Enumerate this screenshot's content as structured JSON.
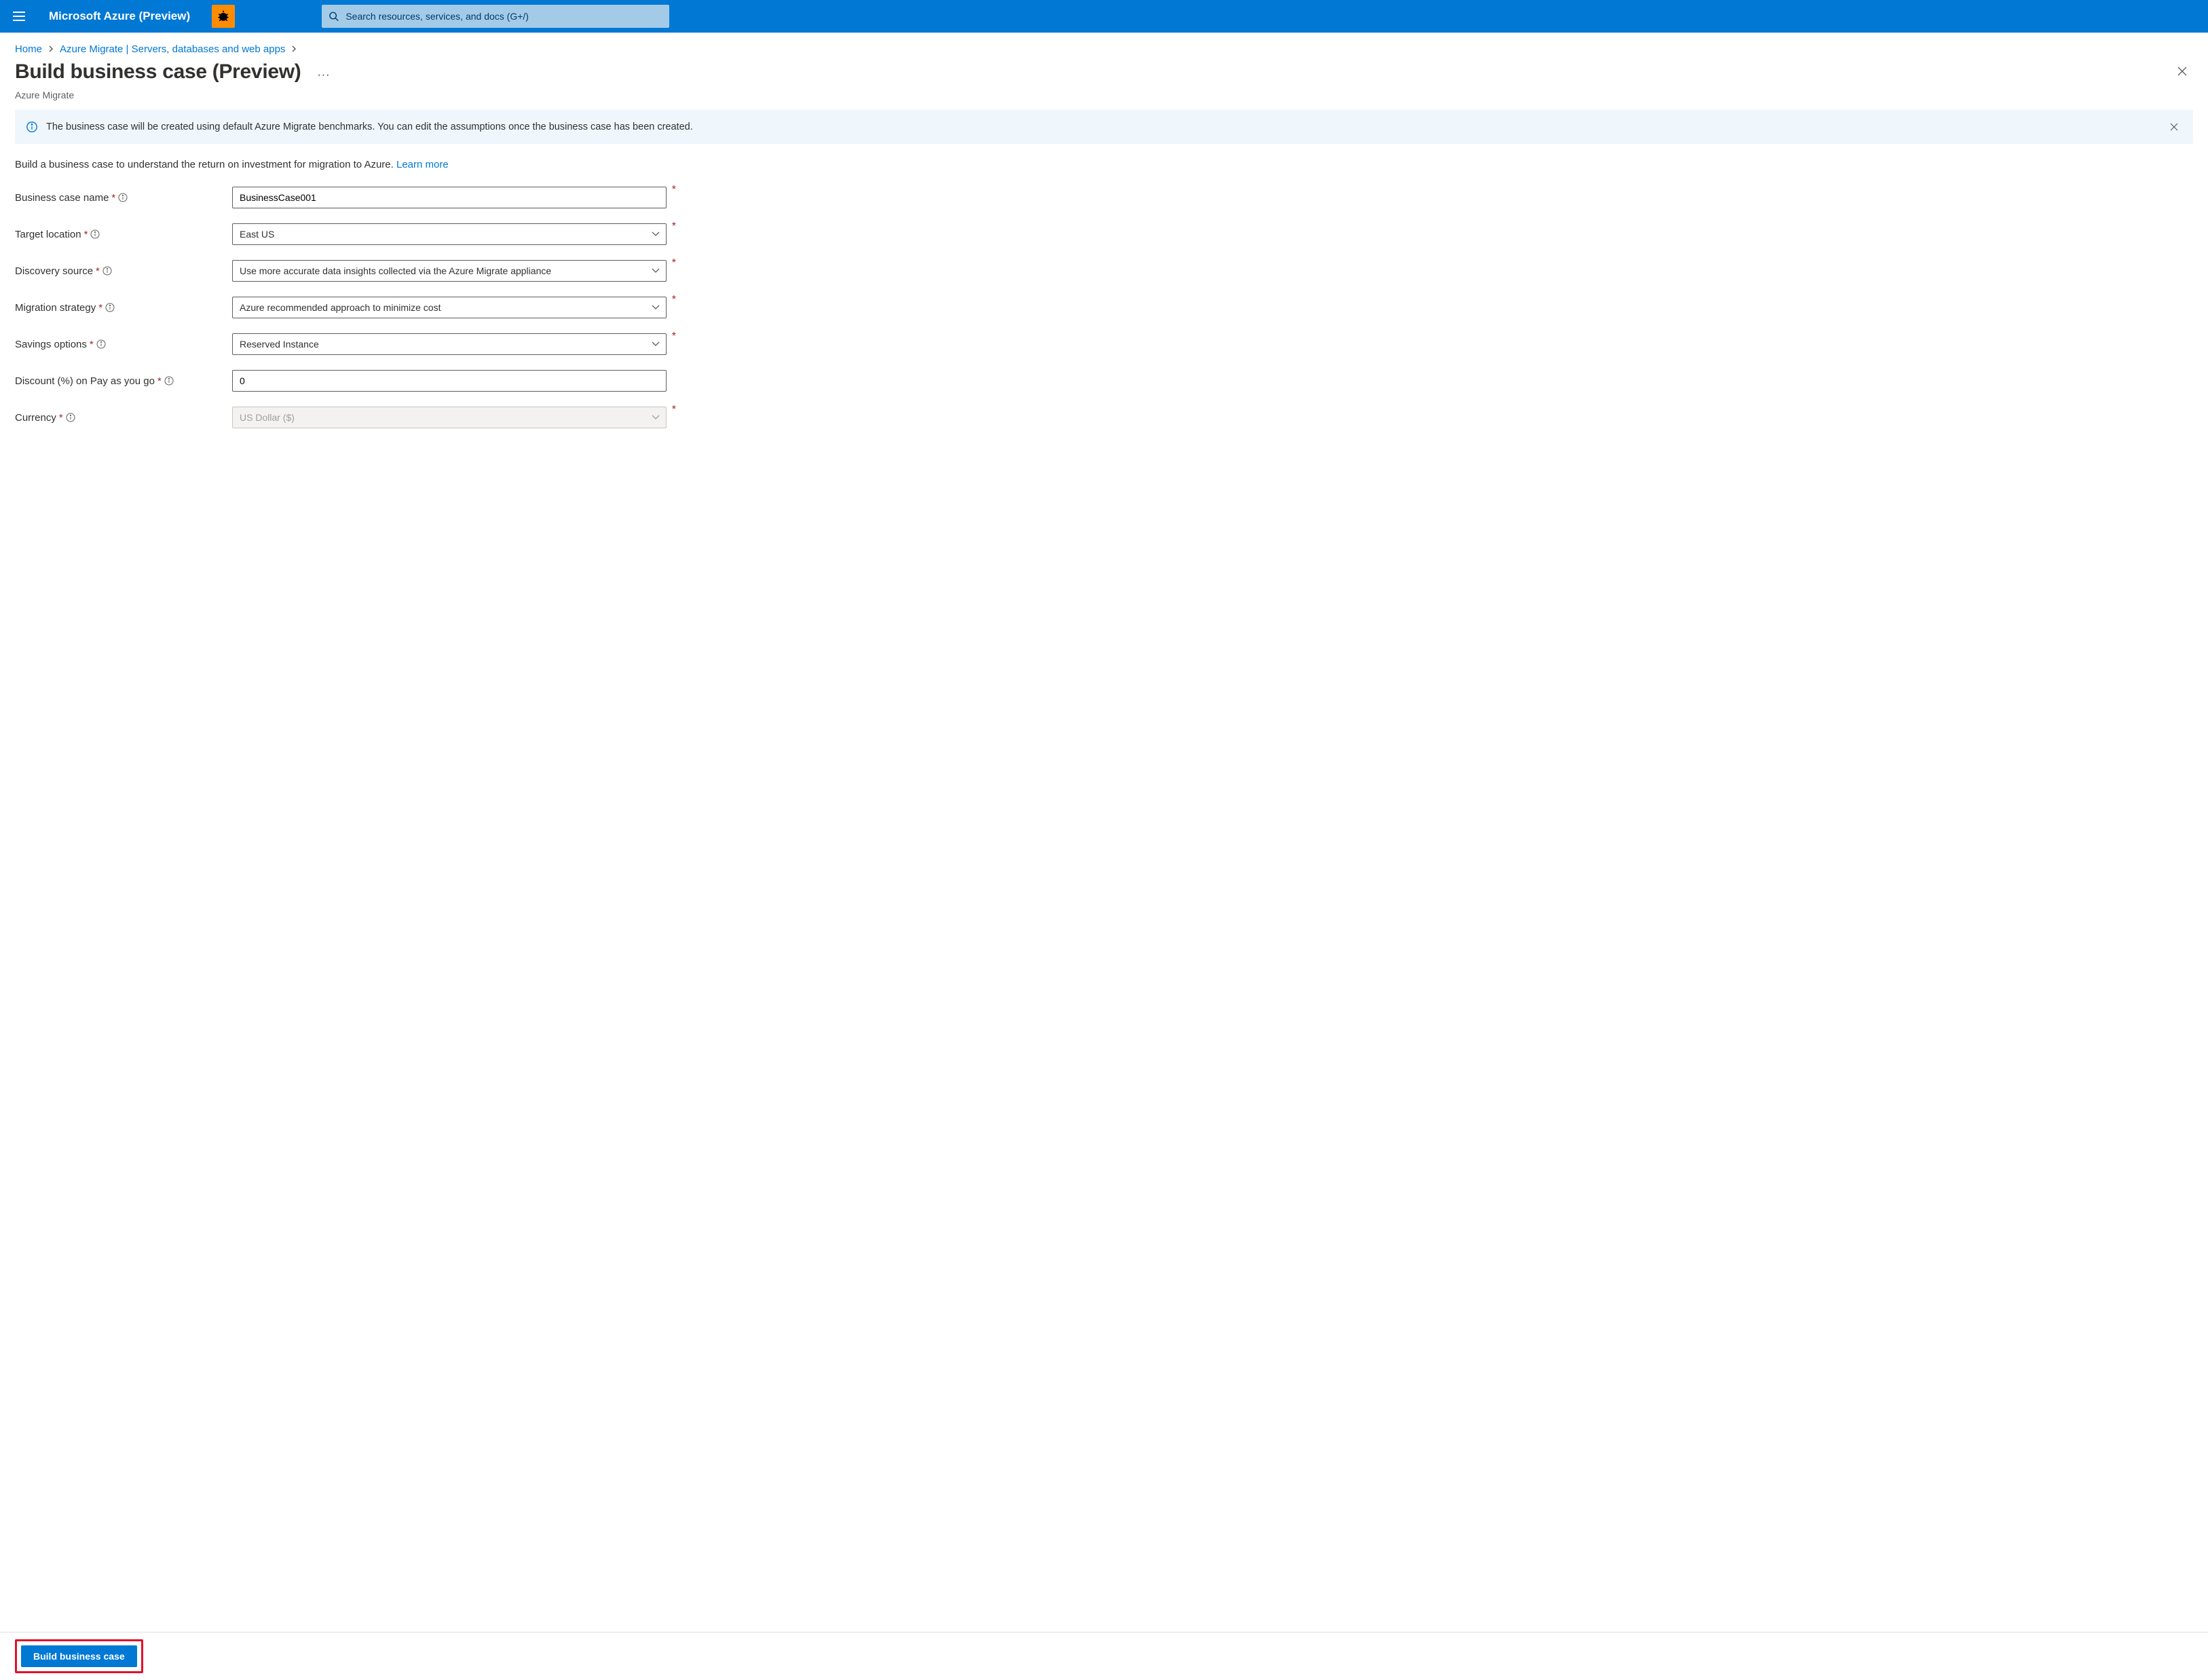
{
  "topbar": {
    "brand": "Microsoft Azure (Preview)",
    "search_placeholder": "Search resources, services, and docs (G+/)"
  },
  "breadcrumb": {
    "items": [
      "Home",
      "Azure Migrate | Servers, databases and web apps"
    ]
  },
  "page": {
    "title": "Build business case (Preview)",
    "subtitle": "Azure Migrate"
  },
  "infobar": {
    "text": "The business case will be created using default Azure Migrate benchmarks. You can edit the assumptions once the business case has been created."
  },
  "desc": {
    "text": "Build a business case to understand the return on investment for migration to Azure. ",
    "link": "Learn more"
  },
  "form": {
    "name": {
      "label": "Business case name",
      "value": "BusinessCase001"
    },
    "location": {
      "label": "Target location",
      "value": "East US"
    },
    "discovery": {
      "label": "Discovery source",
      "value": "Use more accurate data insights collected via the Azure Migrate appliance"
    },
    "strategy": {
      "label": "Migration strategy",
      "value": "Azure recommended approach to minimize cost"
    },
    "savings": {
      "label": "Savings options",
      "value": "Reserved Instance"
    },
    "discount": {
      "label": "Discount (%) on Pay as you go",
      "value": "0"
    },
    "currency": {
      "label": "Currency",
      "value": "US Dollar ($)"
    }
  },
  "footer": {
    "primary": "Build business case"
  }
}
